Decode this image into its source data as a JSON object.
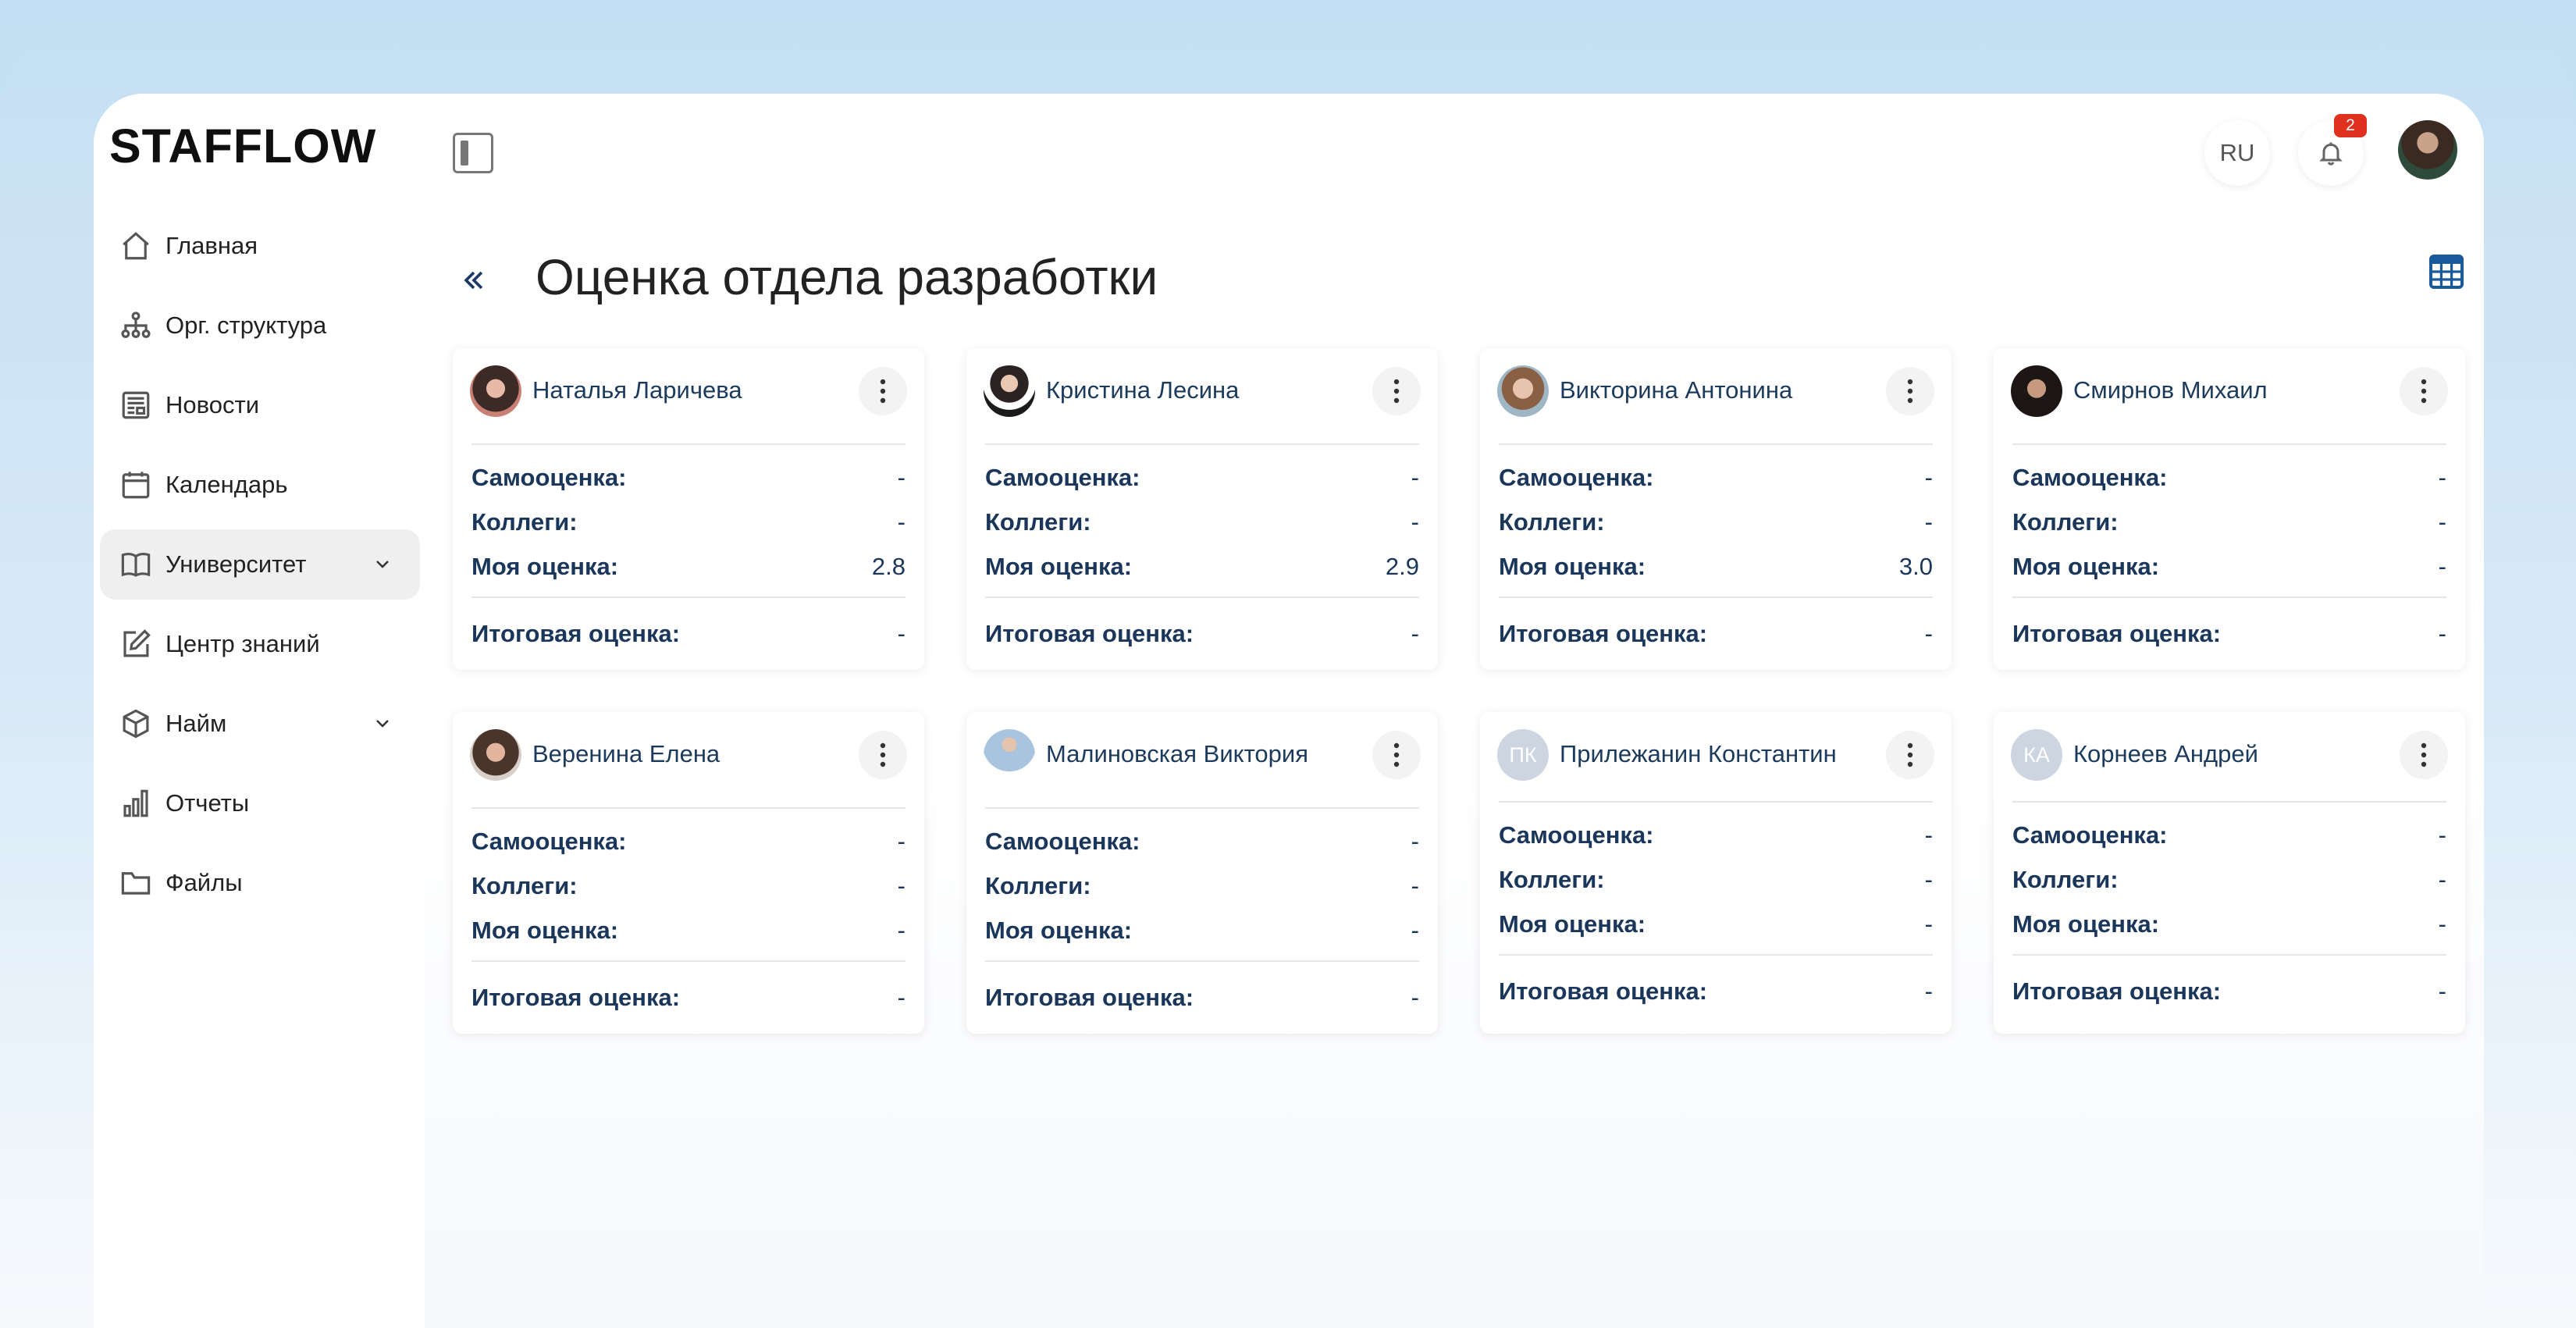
{
  "app": {
    "logo": "STAFFLOW",
    "lang": "RU",
    "notifications_count": "2"
  },
  "sidebar": {
    "items": [
      {
        "label": "Главная",
        "icon": "home-icon"
      },
      {
        "label": "Орг. структура",
        "icon": "org-structure-icon"
      },
      {
        "label": "Новости",
        "icon": "news-icon"
      },
      {
        "label": "Календарь",
        "icon": "calendar-icon"
      },
      {
        "label": "Университет",
        "icon": "book-icon",
        "active": true,
        "expandable": true
      },
      {
        "label": "Центр знаний",
        "icon": "edit-icon"
      },
      {
        "label": "Найм",
        "icon": "cube-icon",
        "expandable": true
      },
      {
        "label": "Отчеты",
        "icon": "bar-chart-icon"
      },
      {
        "label": "Файлы",
        "icon": "folder-icon"
      }
    ]
  },
  "page": {
    "title": "Оценка отдела разработки"
  },
  "labels": {
    "self": "Самооценка:",
    "colleagues": "Коллеги:",
    "mine": "Моя оценка:",
    "final": "Итоговая оценка:"
  },
  "cards": [
    {
      "name": "Наталья Ларичева",
      "initials": "",
      "self": "-",
      "colleagues": "-",
      "mine": "2.8",
      "final": "-"
    },
    {
      "name": "Кристина Лесина",
      "initials": "",
      "self": "-",
      "colleagues": "-",
      "mine": "2.9",
      "final": "-"
    },
    {
      "name": "Викторина Антонина",
      "initials": "",
      "self": "-",
      "colleagues": "-",
      "mine": "3.0",
      "final": "-"
    },
    {
      "name": "Смирнов Михаил",
      "initials": "",
      "self": "-",
      "colleagues": "-",
      "mine": "-",
      "final": "-"
    },
    {
      "name": "Веренина Елена",
      "initials": "",
      "self": "-",
      "colleagues": "-",
      "mine": "-",
      "final": "-"
    },
    {
      "name": "Малиновская Виктория",
      "initials": "",
      "self": "-",
      "colleagues": "-",
      "mine": "-",
      "final": "-"
    },
    {
      "name": "Прилежанин Константин",
      "initials": "ПК",
      "self": "-",
      "colleagues": "-",
      "mine": "-",
      "final": "-"
    },
    {
      "name": "Корнеев Андрей",
      "initials": "КА",
      "self": "-",
      "colleagues": "-",
      "mine": "-",
      "final": "-"
    }
  ],
  "colors": {
    "accent": "#1b3a5c",
    "badge": "#e0301e",
    "initials_avatar": "#cdd6e0"
  }
}
